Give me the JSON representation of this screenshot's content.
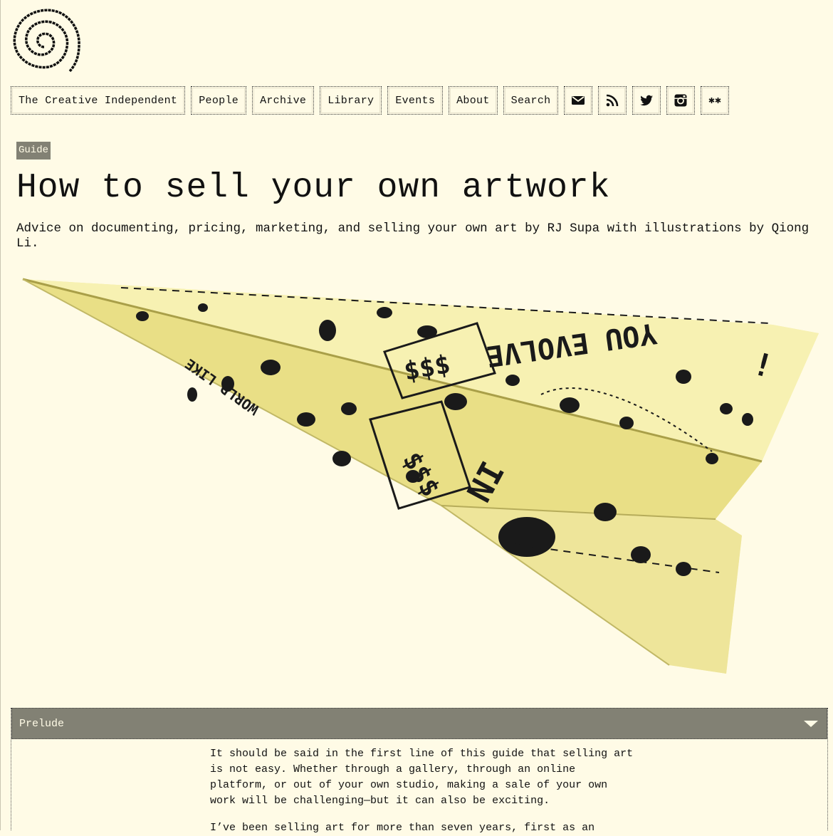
{
  "nav": {
    "items": [
      "The Creative Independent",
      "People",
      "Archive",
      "Library",
      "Events",
      "About",
      "Search"
    ],
    "icons": [
      "mail-icon",
      "rss-icon",
      "twitter-icon",
      "instagram-icon",
      "asterisks-icon"
    ]
  },
  "article": {
    "tag": "Guide",
    "title": "How to sell your own artwork",
    "subtitle": "Advice on documenting, pricing, marketing, and selling your own art by RJ Supa with illustrations by Qiong Li.",
    "hero_illustration": {
      "words": [
        "YOU EVOLVE",
        "IN",
        "WORLD LIKE",
        "$$$",
        "$$$",
        "!"
      ]
    }
  },
  "prelude": {
    "label": "Prelude",
    "paragraphs": [
      "It should be said in the first line of this guide that selling art is not easy. Whether through a gallery, through an online platform, or out of your own studio, making a sale of your own work will be challenging—but it can also be exciting.",
      "I’ve been selling art for more than seven years, first as an"
    ]
  },
  "colors": {
    "background": "#fffbe6",
    "accent": "#828174",
    "paper": "#f2eba3"
  }
}
